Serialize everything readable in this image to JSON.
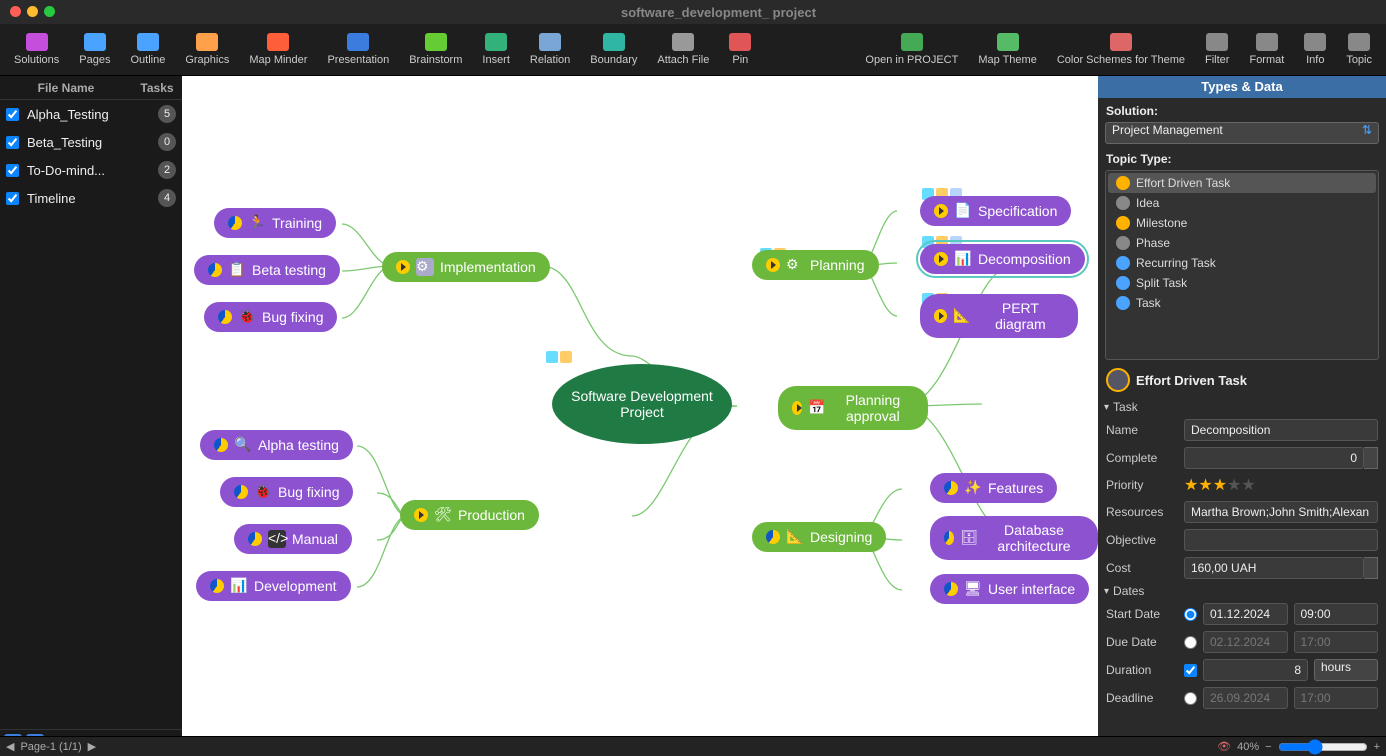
{
  "window": {
    "title": "software_development_ project"
  },
  "toolbar": [
    {
      "id": "solutions",
      "label": "Solutions",
      "c": "#c64edc"
    },
    {
      "id": "pages",
      "label": "Pages",
      "c": "#4aa3ff"
    },
    {
      "id": "outline",
      "label": "Outline",
      "c": "#4aa3ff"
    },
    {
      "id": "graphics",
      "label": "Graphics",
      "c": "#ffa14a"
    },
    {
      "id": "mapminder",
      "label": "Map Minder",
      "c": "#ff5e3a"
    },
    {
      "id": "presentation",
      "label": "Presentation",
      "c": "#3a7dde"
    },
    {
      "id": "brainstorm",
      "label": "Brainstorm",
      "c": "#66cc33"
    },
    {
      "id": "insert",
      "label": "Insert",
      "c": "#33b17a"
    },
    {
      "id": "relation",
      "label": "Relation",
      "c": "#7aa6d6"
    },
    {
      "id": "boundary",
      "label": "Boundary",
      "c": "#2fb7a3"
    },
    {
      "id": "attach",
      "label": "Attach File",
      "c": "#999"
    },
    {
      "id": "pin",
      "label": "Pin",
      "c": "#e05555"
    },
    {
      "id": "openproject",
      "label": "Open in PROJECT",
      "c": "#44aa55"
    },
    {
      "id": "maptheme",
      "label": "Map Theme",
      "c": "#55bb66"
    },
    {
      "id": "colorschemes",
      "label": "Color Schemes for Theme",
      "c": "#d66"
    },
    {
      "id": "filter",
      "label": "Filter",
      "c": "#888"
    },
    {
      "id": "format",
      "label": "Format",
      "c": "#888"
    },
    {
      "id": "info",
      "label": "Info",
      "c": "#888"
    },
    {
      "id": "topic",
      "label": "Topic",
      "c": "#888"
    }
  ],
  "files": {
    "header_name": "File Name",
    "header_tasks": "Tasks",
    "items": [
      {
        "name": "Alpha_Testing",
        "count": "5"
      },
      {
        "name": "Beta_Testing",
        "count": "0"
      },
      {
        "name": "To-Do-mind...",
        "count": "2"
      },
      {
        "name": "Timeline",
        "count": "4"
      }
    ]
  },
  "mindmap": {
    "center": "Software Development Project",
    "implementation": "Implementation",
    "training": "Training",
    "beta": "Beta testing",
    "bugfix1": "Bug fixing",
    "production": "Production",
    "alpha": "Alpha testing",
    "bugfix2": "Bug fixing",
    "manual": "Manual",
    "development": "Development",
    "planning": "Planning",
    "spec": "Specification",
    "decomp": "Decomposition",
    "pert": "PERT diagram",
    "planningapproval": "Planning approval",
    "designing": "Designing",
    "features": "Features",
    "db": "Database architecture",
    "ui": "User interface"
  },
  "right": {
    "header": "Types & Data",
    "solution_label": "Solution:",
    "solution_value": "Project Management",
    "topic_type_label": "Topic Type:",
    "types": [
      {
        "label": "Effort Driven Task",
        "sel": true,
        "c": "#ffb300"
      },
      {
        "label": "Idea",
        "sel": false,
        "c": "#888"
      },
      {
        "label": "Milestone",
        "sel": false,
        "c": "#ffb300"
      },
      {
        "label": "Phase",
        "sel": false,
        "c": "#888"
      },
      {
        "label": "Recurring Task",
        "sel": false,
        "c": "#4aa3ff"
      },
      {
        "label": "Split Task",
        "sel": false,
        "c": "#4aa3ff"
      },
      {
        "label": "Task",
        "sel": false,
        "c": "#4aa3ff"
      }
    ],
    "selected_type_title": "Effort Driven Task",
    "task_section": "Task",
    "dates_section": "Dates",
    "fields": {
      "name_label": "Name",
      "name": "Decomposition",
      "complete_label": "Complete",
      "complete": "0",
      "priority_label": "Priority",
      "priority": 3,
      "resources_label": "Resources",
      "resources": "Martha Brown;John Smith;Alexan",
      "objective_label": "Objective",
      "objective": "",
      "cost_label": "Cost",
      "cost": "160,00 UAH",
      "start_label": "Start Date",
      "start_date": "01.12.2024",
      "start_time": "09:00",
      "due_label": "Due Date",
      "due_date": "02.12.2024",
      "due_time": "17:00",
      "duration_label": "Duration",
      "duration": "8",
      "duration_unit": "hours",
      "deadline_label": "Deadline",
      "deadline_date": "26.09.2024",
      "deadline_time": "17:00"
    }
  },
  "footer": {
    "page": "Page-1 (1/1)",
    "zoom": "40%"
  }
}
